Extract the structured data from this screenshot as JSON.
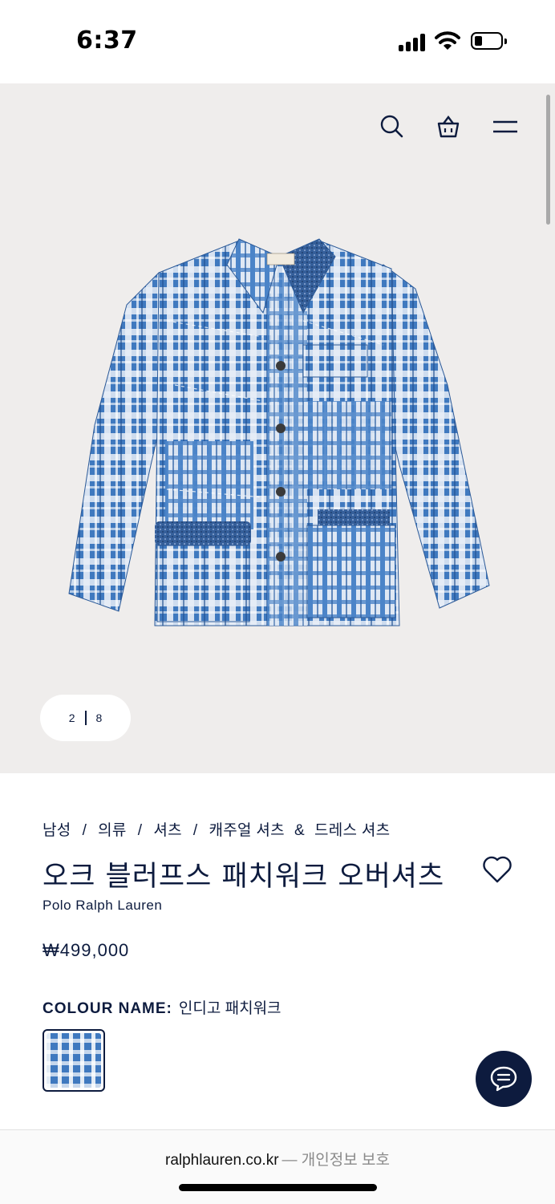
{
  "status": {
    "time": "6:37"
  },
  "header": {
    "icons": [
      "search-icon",
      "shopping-bag-icon",
      "menu-icon"
    ]
  },
  "gallery": {
    "current": "2",
    "total": "8"
  },
  "product": {
    "breadcrumb": [
      "남성",
      "의류",
      "셔츠",
      "캐주얼 셔츠",
      "&",
      "드레스 셔츠"
    ],
    "title": "오크 블러프스 패치워크 오버셔츠",
    "brand": "Polo Ralph Lauren",
    "price": "₩499,000",
    "colour_label": "COLOUR NAME:",
    "colour_value": "인디고 패치워크"
  },
  "footer": {
    "domain": "ralphlauren.co.kr",
    "privacy": "— 개인정보 보호"
  },
  "colors": {
    "navy": "#0d1b3e",
    "hero_bg": "#efedec",
    "plaid_blue": "#3f79bf"
  }
}
